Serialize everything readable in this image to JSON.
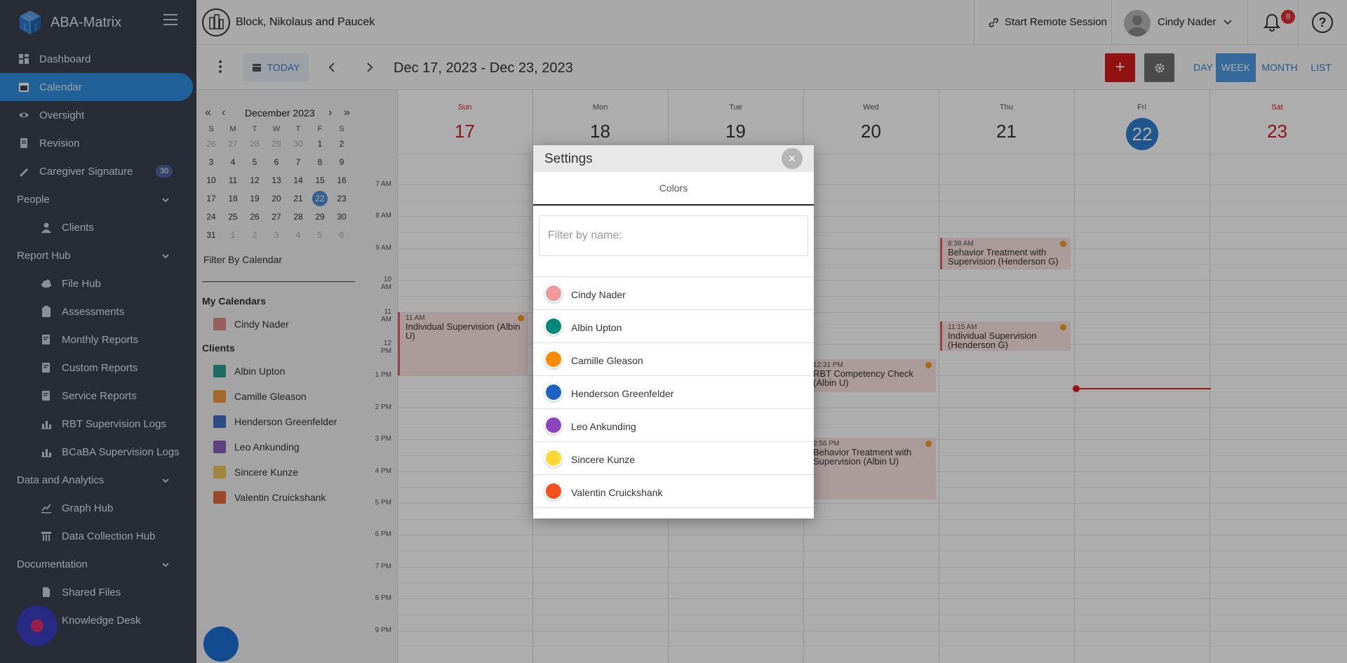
{
  "app": {
    "name": "ABA-Matrix"
  },
  "sidebar": {
    "items": [
      {
        "label": "Dashboard",
        "icon": "dashboard-icon",
        "level": "top"
      },
      {
        "label": "Calendar",
        "icon": "calendar-icon",
        "level": "top",
        "active": true
      },
      {
        "label": "Oversight",
        "icon": "eye-icon",
        "level": "top"
      },
      {
        "label": "Revision",
        "icon": "document-icon",
        "level": "top"
      },
      {
        "label": "Caregiver Signature",
        "icon": "signature-icon",
        "level": "top",
        "badge": "30"
      },
      {
        "label": "People",
        "level": "section"
      },
      {
        "label": "Clients",
        "icon": "person-icon",
        "level": "sub"
      },
      {
        "label": "Report Hub",
        "level": "section"
      },
      {
        "label": "File Hub",
        "icon": "cloud-icon",
        "level": "sub"
      },
      {
        "label": "Assessments",
        "icon": "clipboard-icon",
        "level": "sub"
      },
      {
        "label": "Monthly Reports",
        "icon": "report-icon",
        "level": "sub"
      },
      {
        "label": "Custom Reports",
        "icon": "report-icon",
        "level": "sub"
      },
      {
        "label": "Service Reports",
        "icon": "report-icon",
        "level": "sub"
      },
      {
        "label": "RBT Supervision Logs",
        "icon": "chart-icon",
        "level": "sub"
      },
      {
        "label": "BCaBA Supervision Logs",
        "icon": "chart-icon",
        "level": "sub"
      },
      {
        "label": "Data and Analytics",
        "level": "section"
      },
      {
        "label": "Graph Hub",
        "icon": "graph-icon",
        "level": "sub"
      },
      {
        "label": "Data Collection Hub",
        "icon": "collection-icon",
        "level": "sub"
      },
      {
        "label": "Documentation",
        "level": "section"
      },
      {
        "label": "Shared Files",
        "icon": "file-icon",
        "level": "sub"
      },
      {
        "label": "Knowledge Desk",
        "icon": "book-icon",
        "level": "sub"
      }
    ]
  },
  "topbar": {
    "org_name": "Block, Nikolaus and Paucek",
    "remote_label": "Start Remote Session",
    "user_name": "Cindy Nader",
    "notification_count": "8",
    "help_label": "?"
  },
  "toolbar": {
    "today_label": "TODAY",
    "range": "Dec 17, 2023 - Dec 23, 2023",
    "add_label": "+",
    "views": [
      "DAY",
      "WEEK",
      "MONTH",
      "LIST"
    ],
    "active_view": "WEEK"
  },
  "minical": {
    "month": "December 2023",
    "dow": [
      "S",
      "M",
      "T",
      "W",
      "T",
      "F",
      "S"
    ],
    "weeks": [
      [
        "26",
        "27",
        "28",
        "29",
        "30",
        "1",
        "2"
      ],
      [
        "3",
        "4",
        "5",
        "6",
        "7",
        "8",
        "9"
      ],
      [
        "10",
        "11",
        "12",
        "13",
        "14",
        "15",
        "16"
      ],
      [
        "17",
        "18",
        "19",
        "20",
        "21",
        "22",
        "23"
      ],
      [
        "24",
        "25",
        "26",
        "27",
        "28",
        "29",
        "30"
      ],
      [
        "31",
        "1",
        "2",
        "3",
        "4",
        "5",
        "6"
      ]
    ],
    "selected": "22"
  },
  "calendars": {
    "filter_label": "Filter By Calendar",
    "my_heading": "My Calendars",
    "my": [
      {
        "name": "Cindy Nader",
        "color": "#e08a8a"
      }
    ],
    "clients_heading": "Clients",
    "clients": [
      {
        "name": "Albin Upton",
        "color": "#2a9d8f"
      },
      {
        "name": "Camille Gleason",
        "color": "#f09a3e"
      },
      {
        "name": "Henderson Greenfelder",
        "color": "#3f72c4"
      },
      {
        "name": "Leo Ankunding",
        "color": "#8f5fc0"
      },
      {
        "name": "Sincere Kunze",
        "color": "#eac55a"
      },
      {
        "name": "Valentin Cruickshank",
        "color": "#e36b3a"
      }
    ]
  },
  "week": {
    "days": [
      {
        "dow": "Sun",
        "num": "17"
      },
      {
        "dow": "Mon",
        "num": "18"
      },
      {
        "dow": "Tue",
        "num": "19"
      },
      {
        "dow": "Wed",
        "num": "20"
      },
      {
        "dow": "Thu",
        "num": "21"
      },
      {
        "dow": "Fri",
        "num": "22"
      },
      {
        "dow": "Sat",
        "num": "23"
      }
    ],
    "hours": [
      "7 AM",
      "8 AM",
      "9 AM",
      "10 AM",
      "11 AM",
      "12 PM",
      "1 PM",
      "2 PM",
      "3 PM",
      "4 PM",
      "5 PM",
      "6 PM",
      "7 PM",
      "8 PM",
      "9 PM"
    ],
    "events": [
      {
        "time": "11 AM",
        "title": "Individual Supervision (Albin U)"
      },
      {
        "time": "8:38 AM",
        "title": "Behavior Treatment with Supervision (Henderson G)"
      },
      {
        "time": "11:15 AM",
        "title": "Individual Supervision (Henderson G)"
      },
      {
        "time": "12:31 PM",
        "title": "RBT Competency Check (Albin U)"
      },
      {
        "time": "2:56 PM",
        "title": "Behavior Treatment with Supervision (Albin U)"
      }
    ]
  },
  "modal": {
    "title": "Settings",
    "close_label": "×",
    "tab": "Colors",
    "filter_placeholder": "Filter by name:",
    "colors": [
      {
        "name": "Cindy Nader",
        "color": "#ef9a9a"
      },
      {
        "name": "Albin Upton",
        "color": "#00897b"
      },
      {
        "name": "Camille Gleason",
        "color": "#fb8c00"
      },
      {
        "name": "Henderson Greenfelder",
        "color": "#1e63c4"
      },
      {
        "name": "Leo Ankunding",
        "color": "#8e44c0"
      },
      {
        "name": "Sincere Kunze",
        "color": "#fdd835"
      },
      {
        "name": "Valentin Cruickshank",
        "color": "#f4511e"
      }
    ]
  }
}
